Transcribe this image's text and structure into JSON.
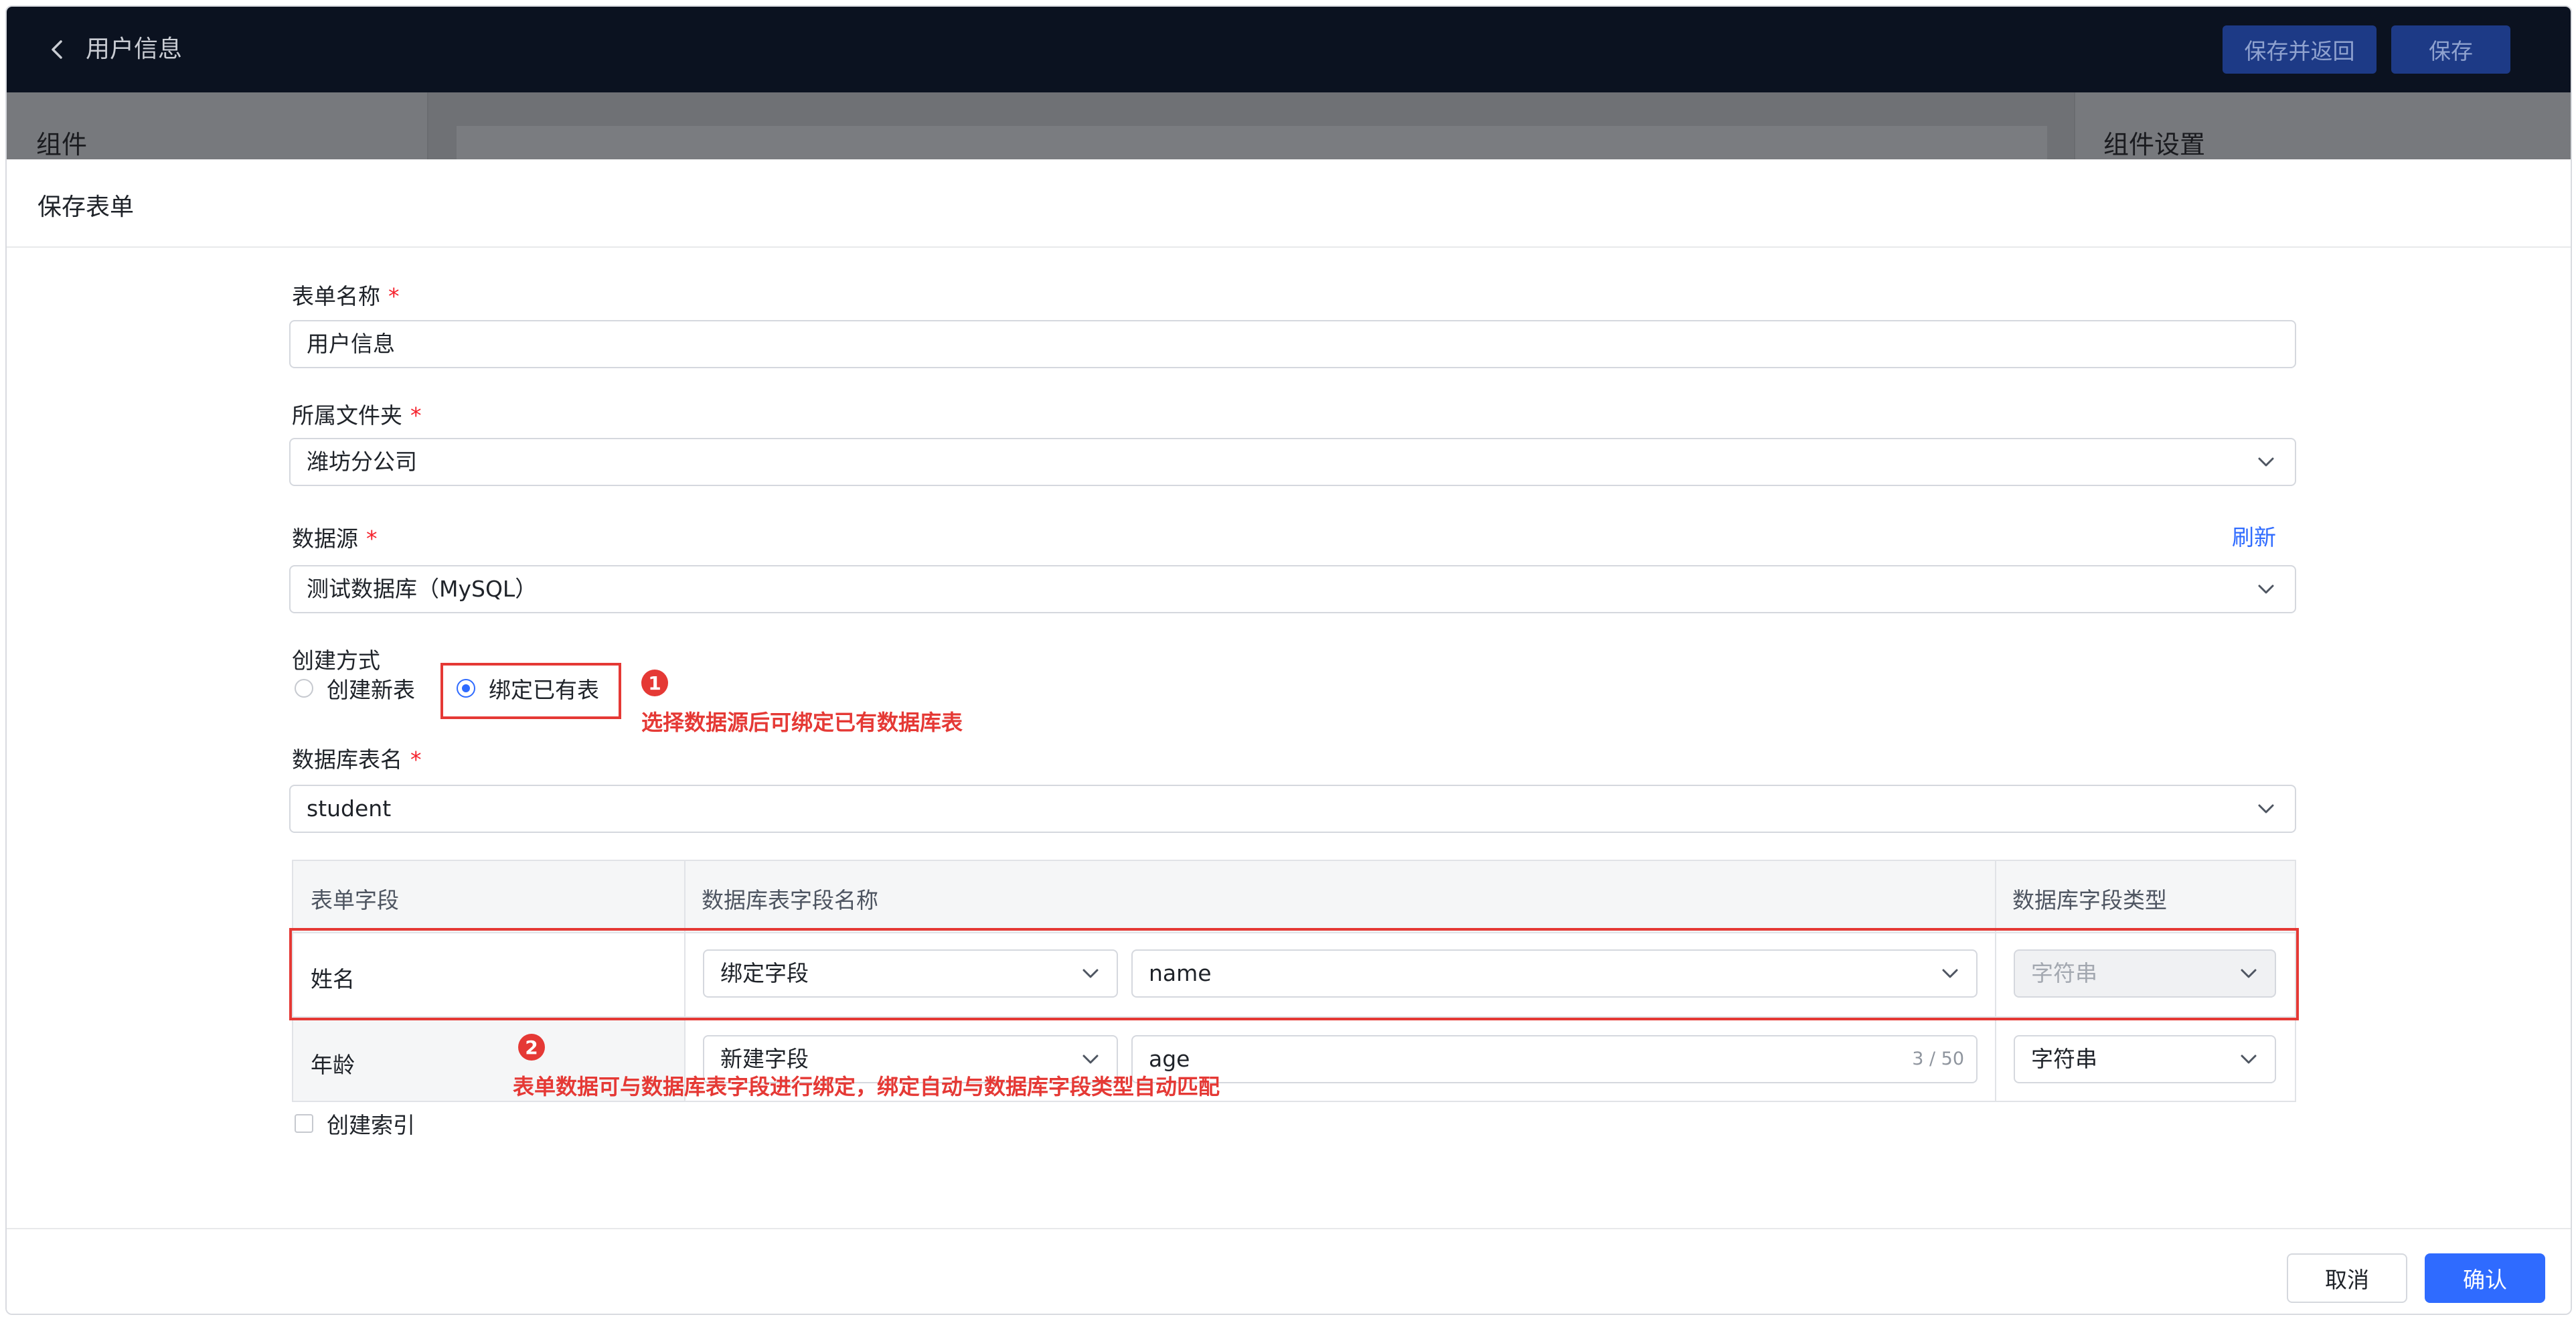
{
  "app": {
    "page_title": "用户信息",
    "save_return_label": "保存并返回",
    "save_label": "保存",
    "left_panel_title": "组件",
    "right_panel_title": "组件设置"
  },
  "modal": {
    "title": "保存表单",
    "form_name": {
      "label": "表单名称",
      "required_mark": "*",
      "value": "用户信息"
    },
    "folder": {
      "label": "所属文件夹",
      "required_mark": "*",
      "value": "潍坊分公司"
    },
    "datasource": {
      "label": "数据源",
      "required_mark": "*",
      "value": "测试数据库（MySQL）",
      "refresh_label": "刷新"
    },
    "create_mode": {
      "label": "创建方式",
      "options": [
        {
          "label": "创建新表",
          "selected": false
        },
        {
          "label": "绑定已有表",
          "selected": true
        }
      ]
    },
    "table_name": {
      "label": "数据库表名",
      "required_mark": "*",
      "value": "student"
    },
    "field_table": {
      "headers": [
        "表单字段",
        "数据库表字段名称",
        "数据库字段类型"
      ],
      "rows": [
        {
          "form_field": "姓名",
          "mode": "绑定字段",
          "db_field": "name",
          "type": "字符串",
          "type_disabled": true
        },
        {
          "form_field": "年龄",
          "mode": "新建字段",
          "db_field": "age",
          "counter": "3 / 50",
          "type": "字符串",
          "type_disabled": false
        }
      ]
    },
    "create_index_label": "创建索引",
    "cancel_label": "取消",
    "confirm_label": "确认"
  },
  "annotations": [
    {
      "number": "1",
      "text": "选择数据源后可绑定已有数据库表"
    },
    {
      "number": "2",
      "text": "表单数据可与数据库表字段进行绑定，绑定自动与数据库字段类型自动匹配"
    }
  ],
  "colors": {
    "primary": "#2f6bff",
    "annotation_red": "#e53935",
    "topbar": "#0b1220"
  }
}
